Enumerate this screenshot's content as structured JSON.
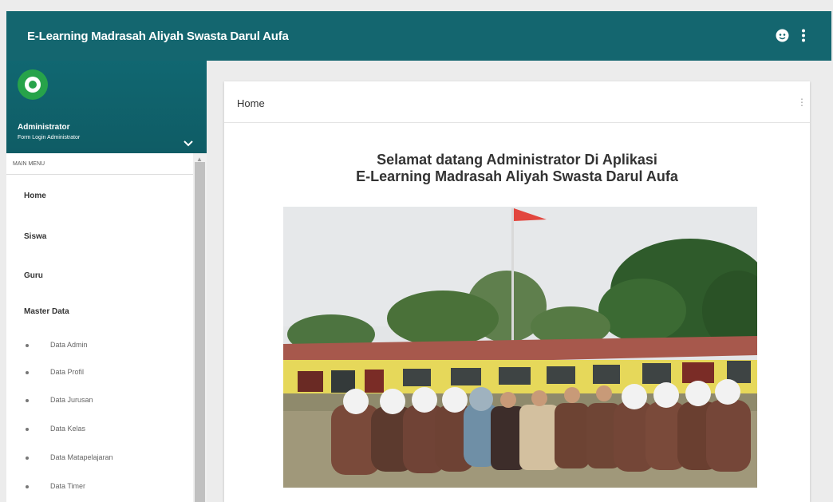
{
  "topbar": {
    "title": "E-Learning Madrasah Aliyah Swasta Darul Aufa",
    "icons": [
      "account-icon",
      "more-vert-icon"
    ],
    "color": "#14666f"
  },
  "sidebar": {
    "user_name": "Administrator",
    "user_subtitle": "Form Login Administrator",
    "menu_header": "MAIN MENU",
    "items": [
      {
        "label": "Home"
      },
      {
        "label": "Siswa"
      },
      {
        "label": "Guru"
      },
      {
        "label": "Master Data"
      }
    ],
    "subitems": [
      {
        "label": "Data Admin"
      },
      {
        "label": "Data Profil"
      },
      {
        "label": "Data Jurusan"
      },
      {
        "label": "Data Kelas"
      },
      {
        "label": "Data Matapelajaran"
      },
      {
        "label": "Data Timer"
      }
    ]
  },
  "content": {
    "card_title": "Home",
    "welcome_line1": "Selamat datang Administrator Di Aplikasi",
    "welcome_line2": "E-Learning Madrasah Aliyah Swasta Darul Aufa"
  },
  "colors": {
    "header_bg": "#14666f",
    "logo_green": "#27a34a"
  }
}
